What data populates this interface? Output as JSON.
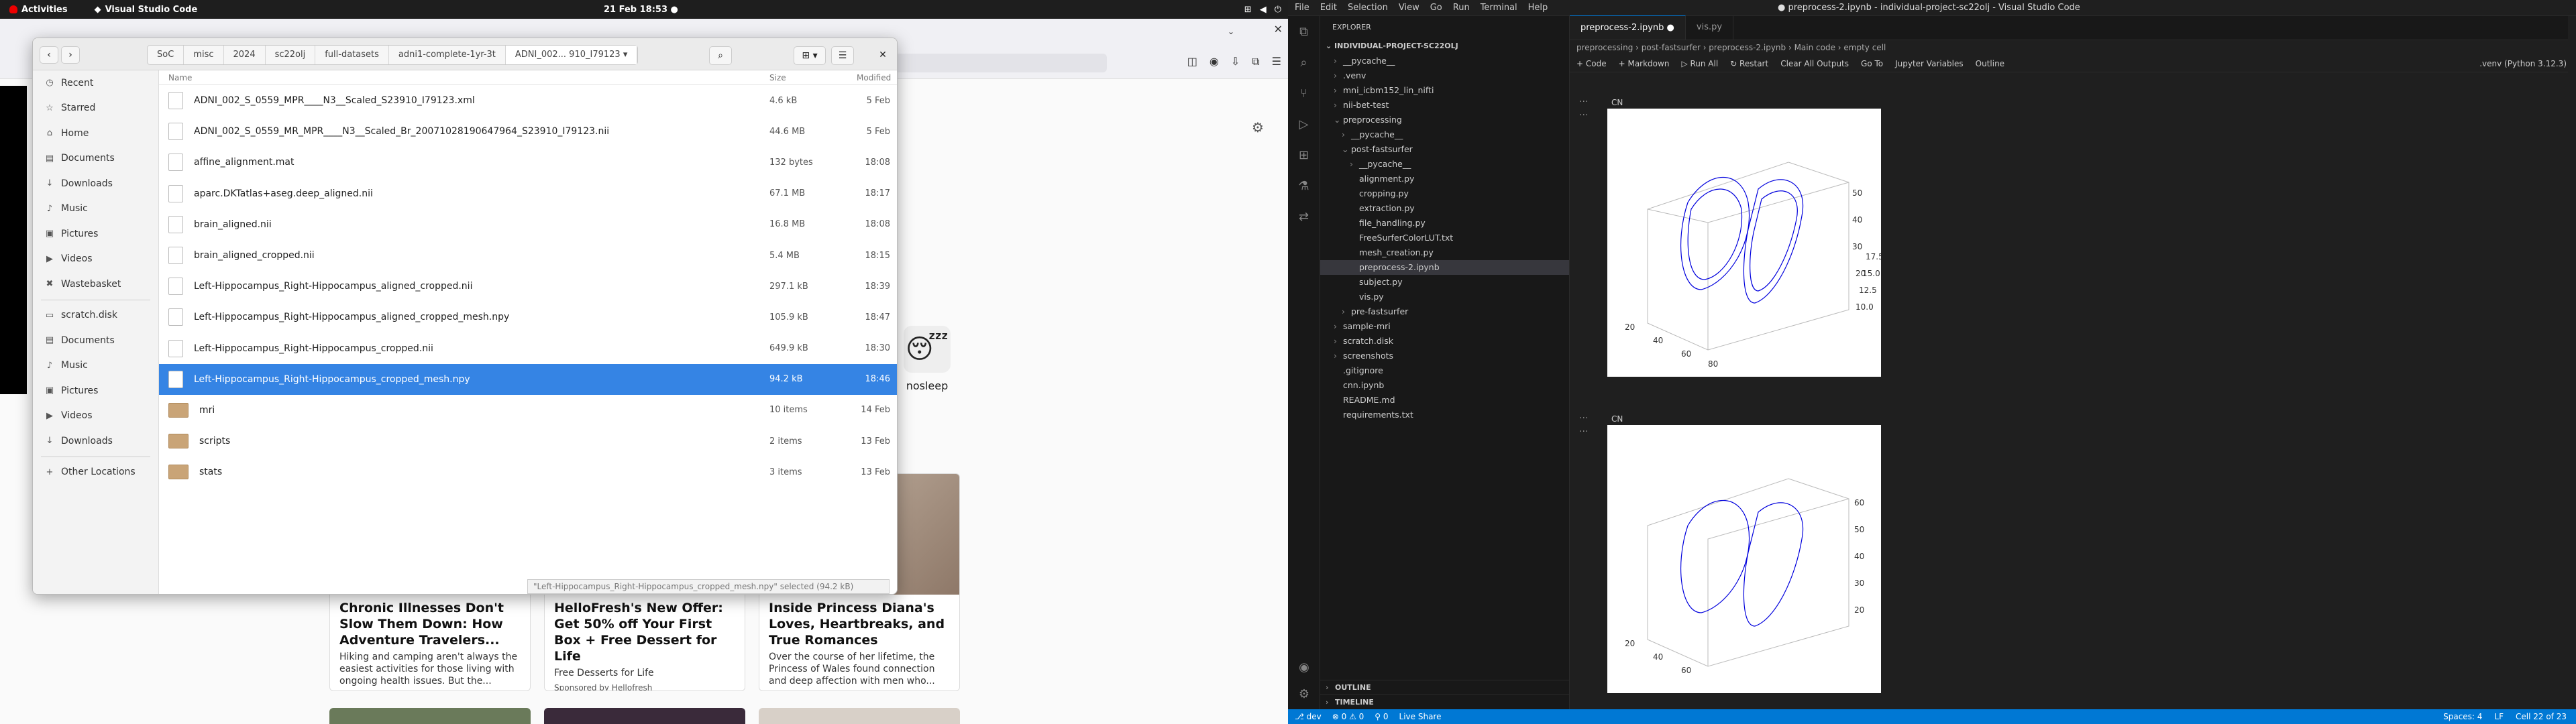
{
  "topbar": {
    "activities": "Activities",
    "app": "Visual Studio Code",
    "clock": "21 Feb  18:53"
  },
  "files": {
    "crumbs": [
      "SoC",
      "misc",
      "2024",
      "sc22olj",
      "full-datasets",
      "adni1-complete-1yr-3t",
      "ADNI_002... 910_I79123"
    ],
    "sidebar": [
      {
        "icon": "clock-icon",
        "glyph": "◷",
        "label": "Recent"
      },
      {
        "icon": "star-icon",
        "glyph": "☆",
        "label": "Starred"
      },
      {
        "icon": "home-icon",
        "glyph": "⌂",
        "label": "Home"
      },
      {
        "icon": "document-icon",
        "glyph": "▤",
        "label": "Documents"
      },
      {
        "icon": "download-icon",
        "glyph": "↓",
        "label": "Downloads"
      },
      {
        "icon": "music-icon",
        "glyph": "♪",
        "label": "Music"
      },
      {
        "icon": "picture-icon",
        "glyph": "▣",
        "label": "Pictures"
      },
      {
        "icon": "video-icon",
        "glyph": "▶",
        "label": "Videos"
      },
      {
        "icon": "trash-icon",
        "glyph": "✖",
        "label": "Wastebasket"
      },
      {
        "icon": "folder-icon",
        "glyph": "▭",
        "label": "scratch.disk"
      },
      {
        "icon": "document-icon",
        "glyph": "▤",
        "label": "Documents"
      },
      {
        "icon": "music-icon",
        "glyph": "♪",
        "label": "Music"
      },
      {
        "icon": "picture-icon",
        "glyph": "▣",
        "label": "Pictures"
      },
      {
        "icon": "video-icon",
        "glyph": "▶",
        "label": "Videos"
      },
      {
        "icon": "download-icon",
        "glyph": "↓",
        "label": "Downloads"
      },
      {
        "icon": "plus-icon",
        "glyph": "+",
        "label": "Other Locations"
      }
    ],
    "columns": {
      "name": "Name",
      "size": "Size",
      "modified": "Modified"
    },
    "rows": [
      {
        "name": "ADNI_002_S_0559_MPR____N3__Scaled_S23910_I79123.xml",
        "size": "4.6 kB",
        "modified": "5 Feb",
        "dir": false
      },
      {
        "name": "ADNI_002_S_0559_MR_MPR____N3__Scaled_Br_20071028190647964_S23910_I79123.nii",
        "size": "44.6 MB",
        "modified": "5 Feb",
        "dir": false
      },
      {
        "name": "affine_alignment.mat",
        "size": "132 bytes",
        "modified": "18:08",
        "dir": false
      },
      {
        "name": "aparc.DKTatlas+aseg.deep_aligned.nii",
        "size": "67.1 MB",
        "modified": "18:17",
        "dir": false
      },
      {
        "name": "brain_aligned.nii",
        "size": "16.8 MB",
        "modified": "18:08",
        "dir": false
      },
      {
        "name": "brain_aligned_cropped.nii",
        "size": "5.4 MB",
        "modified": "18:15",
        "dir": false
      },
      {
        "name": "Left-Hippocampus_Right-Hippocampus_aligned_cropped.nii",
        "size": "297.1 kB",
        "modified": "18:39",
        "dir": false
      },
      {
        "name": "Left-Hippocampus_Right-Hippocampus_aligned_cropped_mesh.npy",
        "size": "105.9 kB",
        "modified": "18:47",
        "dir": false
      },
      {
        "name": "Left-Hippocampus_Right-Hippocampus_cropped.nii",
        "size": "649.9 kB",
        "modified": "18:30",
        "dir": false
      },
      {
        "name": "Left-Hippocampus_Right-Hippocampus_cropped_mesh.npy",
        "size": "94.2 kB",
        "modified": "18:46",
        "dir": false,
        "selected": true
      },
      {
        "name": "mri",
        "size": "10 items",
        "modified": "14 Feb",
        "dir": true
      },
      {
        "name": "scripts",
        "size": "2 items",
        "modified": "13 Feb",
        "dir": true
      },
      {
        "name": "stats",
        "size": "3 items",
        "modified": "13 Feb",
        "dir": true
      }
    ],
    "status": "\"Left-Hippocampus_Right-Hippocampus_cropped_mesh.npy\" selected (94.2 kB)"
  },
  "browser": {
    "nosleep": "nosleep",
    "news": [
      {
        "title": "Chronic Illnesses Don't Slow Them Down: How Adventure Travelers...",
        "text": "Hiking and camping aren't always the easiest activities for those living with ongoing health issues. But the...",
        "sponsor": ""
      },
      {
        "title": "HelloFresh's New Offer: Get 50% off Your First Box + Free Dessert for Life",
        "text": "Free Desserts for Life",
        "sponsor": "Sponsored by Hellofresh"
      },
      {
        "title": "Inside Princess Diana's Loves, Heartbreaks, and True Romances",
        "text": "Over the course of her lifetime, the Princess of Wales found connection and deep affection with men who...",
        "sponsor": ""
      }
    ]
  },
  "vscode": {
    "menu": [
      "File",
      "Edit",
      "Selection",
      "View",
      "Go",
      "Run",
      "Terminal",
      "Help"
    ],
    "title": "● preprocess-2.ipynb - individual-project-sc22olj - Visual Studio Code",
    "explorer": "EXPLORER",
    "project": "INDIVIDUAL-PROJECT-SC22OLJ",
    "tree": [
      {
        "label": "__pycache__",
        "indent": 1,
        "ch": "›"
      },
      {
        "label": ".venv",
        "indent": 1,
        "ch": "›"
      },
      {
        "label": "mni_icbm152_lin_nifti",
        "indent": 1,
        "ch": "›"
      },
      {
        "label": "nii-bet-test",
        "indent": 1,
        "ch": "›"
      },
      {
        "label": "preprocessing",
        "indent": 1,
        "ch": "⌄"
      },
      {
        "label": "__pycache__",
        "indent": 2,
        "ch": "›"
      },
      {
        "label": "post-fastsurfer",
        "indent": 2,
        "ch": "⌄"
      },
      {
        "label": "__pycache__",
        "indent": 3,
        "ch": "›"
      },
      {
        "label": "alignment.py",
        "indent": 3,
        "ch": ""
      },
      {
        "label": "cropping.py",
        "indent": 3,
        "ch": ""
      },
      {
        "label": "extraction.py",
        "indent": 3,
        "ch": ""
      },
      {
        "label": "file_handling.py",
        "indent": 3,
        "ch": ""
      },
      {
        "label": "FreeSurferColorLUT.txt",
        "indent": 3,
        "ch": ""
      },
      {
        "label": "mesh_creation.py",
        "indent": 3,
        "ch": ""
      },
      {
        "label": "preprocess-2.ipynb",
        "indent": 3,
        "ch": "",
        "active": true
      },
      {
        "label": "subject.py",
        "indent": 3,
        "ch": ""
      },
      {
        "label": "vis.py",
        "indent": 3,
        "ch": ""
      },
      {
        "label": "pre-fastsurfer",
        "indent": 2,
        "ch": "›"
      },
      {
        "label": "sample-mri",
        "indent": 1,
        "ch": "›"
      },
      {
        "label": "scratch.disk",
        "indent": 1,
        "ch": "›"
      },
      {
        "label": "screenshots",
        "indent": 1,
        "ch": "›"
      },
      {
        "label": ".gitignore",
        "indent": 1,
        "ch": ""
      },
      {
        "label": "cnn.ipynb",
        "indent": 1,
        "ch": ""
      },
      {
        "label": "README.md",
        "indent": 1,
        "ch": ""
      },
      {
        "label": "requirements.txt",
        "indent": 1,
        "ch": ""
      }
    ],
    "outline": "OUTLINE",
    "timeline": "TIMELINE",
    "tabs": [
      {
        "label": "preprocess-2.ipynb ●",
        "active": true
      },
      {
        "label": "vis.py",
        "active": false
      }
    ],
    "breadcrumb": "preprocessing › post-fastsurfer › preprocess-2.ipynb › Main code › empty cell",
    "toolbar": [
      "+ Code",
      "+ Markdown",
      "▷ Run All",
      "↻ Restart",
      "Clear All Outputs",
      "Go To",
      "Jupyter Variables",
      "Outline"
    ],
    "kernel": ".venv (Python 3.12.3)",
    "cells": [
      {
        "label": "CN"
      },
      {
        "label": "CN"
      }
    ],
    "status": {
      "left": [
        "⎇ dev",
        "⊗ 0 ⚠ 0",
        "⚲ 0",
        "Live Share"
      ],
      "right": [
        "Spaces: 4",
        "LF",
        "Cell 22 of 23"
      ]
    }
  }
}
